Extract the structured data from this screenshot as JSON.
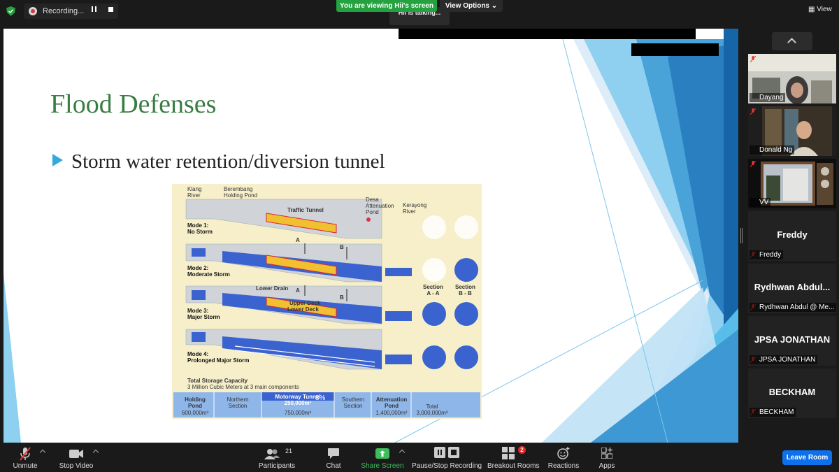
{
  "top": {
    "recording_label": "Recording...",
    "viewing_banner": "You are viewing Hii's screen",
    "view_options": "View Options",
    "talking": "Hii is talking...",
    "view_button": "View"
  },
  "slide": {
    "title": "Flood Defenses",
    "bullet": "Storm water retention/diversion tunnel",
    "diagram": {
      "klang": "Klang\nRiver",
      "berembang": "Berembang\nHolding Pond",
      "desa": "Desa\nAttenuation\nPond",
      "kerayong": "Kerayong\nRiver",
      "traffic_tunnel": "Traffic Tunnel",
      "mode1": "Mode 1:\nNo Storm",
      "mode2": "Mode 2:\nModerate Storm",
      "mode3": "Mode 3:\nMajor Storm",
      "mode4": "Mode 4:\nProlonged Major Storm",
      "lower_drain": "Lower Drain",
      "upper_deck": "Upper Deck",
      "lower_deck": "Lower Deck",
      "arrow_a": "A",
      "arrow_b": "B",
      "section_aa": "Section\nA - A",
      "section_bb": "Section\nB - B",
      "capacity_title": "Total Storage Capacity",
      "capacity_sub": "3 Million Cubic Meters at 3 main components",
      "table": [
        {
          "head": "Holding\nPond",
          "value": "600,000m³"
        },
        {
          "head": "Northern\nSection",
          "value": ""
        },
        {
          "head": "Motorway Tunnel\n250,000m³",
          "value": "750,000m³",
          "pct": "8%"
        },
        {
          "head": "Southern\nSection",
          "value": ""
        },
        {
          "head": "Attenuation\nPond",
          "value": "1,400,000m³"
        },
        {
          "head": "Total",
          "value": "3,000,000m³"
        }
      ]
    }
  },
  "participants_panel": {
    "tiles": [
      {
        "name": "Dayang",
        "type": "video"
      },
      {
        "name": "Donald Ng",
        "type": "video"
      },
      {
        "name": "VV",
        "type": "video"
      },
      {
        "name": "Freddy",
        "big": "Freddy",
        "type": "name"
      },
      {
        "name": "Rydhwan Abdul @ Me...",
        "big": "Rydhwan  Abdul...",
        "type": "name"
      },
      {
        "name": "JPSA JONATHAN",
        "big": "JPSA JONATHAN",
        "type": "name"
      },
      {
        "name": "BECKHAM",
        "big": "BECKHAM",
        "type": "name"
      }
    ]
  },
  "toolbar": {
    "unmute": "Unmute",
    "stop_video": "Stop Video",
    "participants": "Participants",
    "participants_count": "21",
    "chat": "Chat",
    "share_screen": "Share Screen",
    "pause_stop_recording": "Pause/Stop Recording",
    "breakout_rooms": "Breakout Rooms",
    "breakout_badge": "2",
    "reactions": "Reactions",
    "apps": "Apps",
    "leave_room": "Leave Room"
  },
  "colors": {
    "title_green": "#3a7d44",
    "bullet_blue": "#35a9dd",
    "share_green": "#3bbf5b",
    "leave_blue": "#0e71eb",
    "banner_green": "#23a23f"
  }
}
